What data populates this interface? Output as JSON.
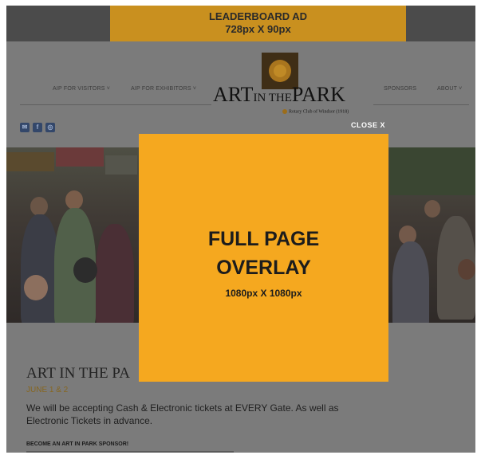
{
  "leaderboard": {
    "line1": "LEADERBOARD AD",
    "line2": "728px X 90px"
  },
  "nav": {
    "items": [
      {
        "label": "AIP FOR VISITORS ˅"
      },
      {
        "label": "AIP FOR EXHIBITORS ˅"
      },
      {
        "label": "SPONSORS"
      },
      {
        "label": "ABOUT ˅"
      }
    ]
  },
  "logo": {
    "art": "ART",
    "in_the": "IN THE",
    "park": "PARK",
    "rotary": "Rotary Club of Windsor (1918)"
  },
  "social": [
    {
      "icon": "email-icon",
      "glyph": "✉"
    },
    {
      "icon": "facebook-icon",
      "glyph": "f"
    },
    {
      "icon": "instagram-icon",
      "glyph": "◎"
    }
  ],
  "content": {
    "title": "ART IN THE PA",
    "date": "JUNE 1 & 2",
    "paragraph": "We will be accepting Cash & Electronic tickets at EVERY Gate. As well as Electronic Tickets in advance.",
    "sponsor_heading": "BECOME AN ART IN PARK SPONSOR!"
  },
  "overlay": {
    "title_line1": "FULL PAGE",
    "title_line2": "OVERLAY",
    "size": "1080px X 1080px",
    "close_label": "CLOSE X"
  },
  "colors": {
    "overlay": "#f5a81f",
    "leaderboard": "#c9901f",
    "dim": "#7b7b7b"
  }
}
